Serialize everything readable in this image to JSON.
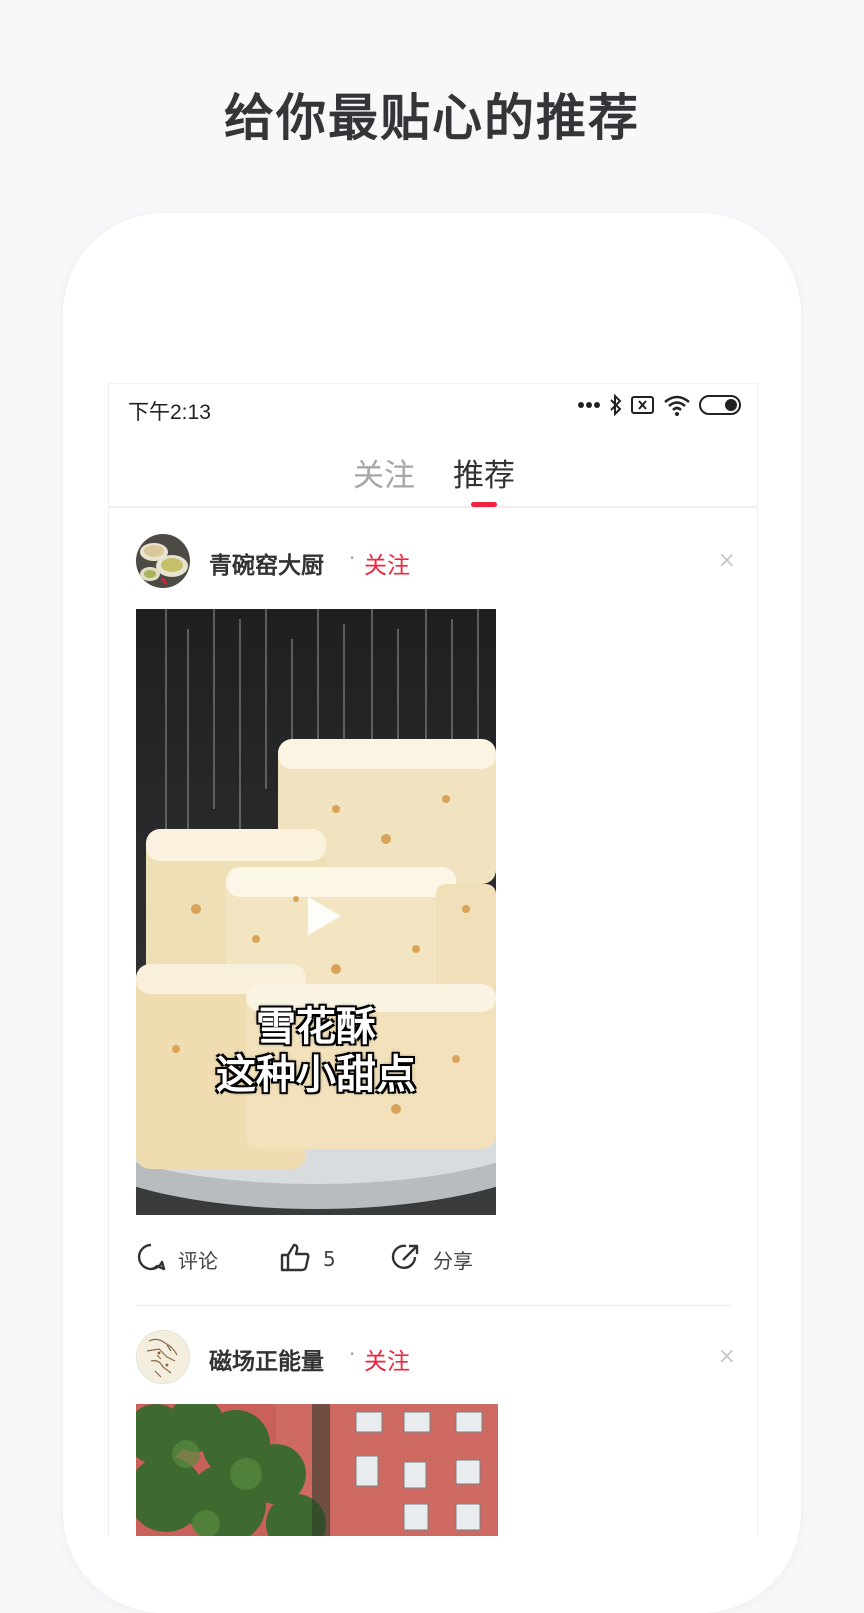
{
  "headline": "给你最贴心的推荐",
  "status_bar": {
    "time": "下午2:13",
    "icons": [
      "more-dots-icon",
      "bluetooth-icon",
      "no-sim-icon",
      "wifi-icon",
      "battery-icon"
    ]
  },
  "tabs": [
    {
      "label": "关注",
      "active": false
    },
    {
      "label": "推荐",
      "active": true
    }
  ],
  "posts": [
    {
      "author": "青碗窑大厨",
      "separator": "·",
      "follow_label": "关注",
      "close_label": "×",
      "video_caption_line1": "雪花酥",
      "video_caption_line2": "这种小甜点",
      "has_play_button": true,
      "actions": {
        "comment_label": "评论",
        "like_count": "5",
        "share_label": "分享"
      }
    },
    {
      "author": "磁场正能量",
      "separator": "·",
      "follow_label": "关注",
      "close_label": "×"
    }
  ],
  "colors": {
    "accent": "#f0243f",
    "background": "#f7f8f9",
    "text_primary": "#333333",
    "tab_inactive": "#a6a6a6"
  }
}
